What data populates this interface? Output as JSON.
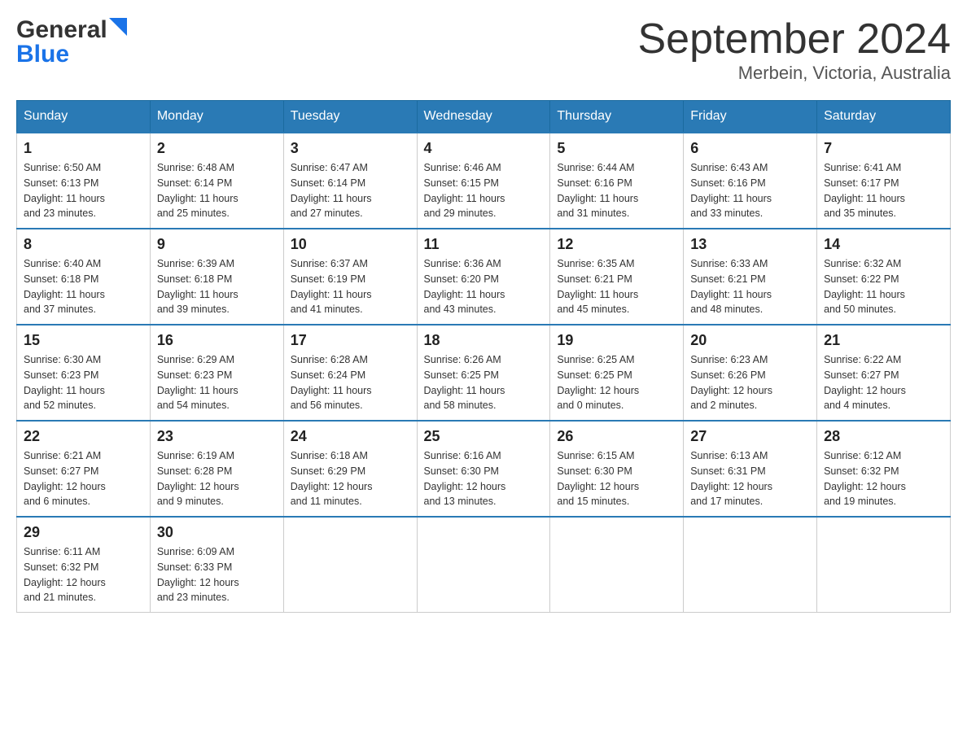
{
  "logo": {
    "general": "General",
    "blue": "Blue"
  },
  "title": "September 2024",
  "subtitle": "Merbein, Victoria, Australia",
  "days": [
    "Sunday",
    "Monday",
    "Tuesday",
    "Wednesday",
    "Thursday",
    "Friday",
    "Saturday"
  ],
  "weeks": [
    [
      {
        "day": "1",
        "sunrise": "6:50 AM",
        "sunset": "6:13 PM",
        "daylight": "11 hours and 23 minutes."
      },
      {
        "day": "2",
        "sunrise": "6:48 AM",
        "sunset": "6:14 PM",
        "daylight": "11 hours and 25 minutes."
      },
      {
        "day": "3",
        "sunrise": "6:47 AM",
        "sunset": "6:14 PM",
        "daylight": "11 hours and 27 minutes."
      },
      {
        "day": "4",
        "sunrise": "6:46 AM",
        "sunset": "6:15 PM",
        "daylight": "11 hours and 29 minutes."
      },
      {
        "day": "5",
        "sunrise": "6:44 AM",
        "sunset": "6:16 PM",
        "daylight": "11 hours and 31 minutes."
      },
      {
        "day": "6",
        "sunrise": "6:43 AM",
        "sunset": "6:16 PM",
        "daylight": "11 hours and 33 minutes."
      },
      {
        "day": "7",
        "sunrise": "6:41 AM",
        "sunset": "6:17 PM",
        "daylight": "11 hours and 35 minutes."
      }
    ],
    [
      {
        "day": "8",
        "sunrise": "6:40 AM",
        "sunset": "6:18 PM",
        "daylight": "11 hours and 37 minutes."
      },
      {
        "day": "9",
        "sunrise": "6:39 AM",
        "sunset": "6:18 PM",
        "daylight": "11 hours and 39 minutes."
      },
      {
        "day": "10",
        "sunrise": "6:37 AM",
        "sunset": "6:19 PM",
        "daylight": "11 hours and 41 minutes."
      },
      {
        "day": "11",
        "sunrise": "6:36 AM",
        "sunset": "6:20 PM",
        "daylight": "11 hours and 43 minutes."
      },
      {
        "day": "12",
        "sunrise": "6:35 AM",
        "sunset": "6:21 PM",
        "daylight": "11 hours and 45 minutes."
      },
      {
        "day": "13",
        "sunrise": "6:33 AM",
        "sunset": "6:21 PM",
        "daylight": "11 hours and 48 minutes."
      },
      {
        "day": "14",
        "sunrise": "6:32 AM",
        "sunset": "6:22 PM",
        "daylight": "11 hours and 50 minutes."
      }
    ],
    [
      {
        "day": "15",
        "sunrise": "6:30 AM",
        "sunset": "6:23 PM",
        "daylight": "11 hours and 52 minutes."
      },
      {
        "day": "16",
        "sunrise": "6:29 AM",
        "sunset": "6:23 PM",
        "daylight": "11 hours and 54 minutes."
      },
      {
        "day": "17",
        "sunrise": "6:28 AM",
        "sunset": "6:24 PM",
        "daylight": "11 hours and 56 minutes."
      },
      {
        "day": "18",
        "sunrise": "6:26 AM",
        "sunset": "6:25 PM",
        "daylight": "11 hours and 58 minutes."
      },
      {
        "day": "19",
        "sunrise": "6:25 AM",
        "sunset": "6:25 PM",
        "daylight": "12 hours and 0 minutes."
      },
      {
        "day": "20",
        "sunrise": "6:23 AM",
        "sunset": "6:26 PM",
        "daylight": "12 hours and 2 minutes."
      },
      {
        "day": "21",
        "sunrise": "6:22 AM",
        "sunset": "6:27 PM",
        "daylight": "12 hours and 4 minutes."
      }
    ],
    [
      {
        "day": "22",
        "sunrise": "6:21 AM",
        "sunset": "6:27 PM",
        "daylight": "12 hours and 6 minutes."
      },
      {
        "day": "23",
        "sunrise": "6:19 AM",
        "sunset": "6:28 PM",
        "daylight": "12 hours and 9 minutes."
      },
      {
        "day": "24",
        "sunrise": "6:18 AM",
        "sunset": "6:29 PM",
        "daylight": "12 hours and 11 minutes."
      },
      {
        "day": "25",
        "sunrise": "6:16 AM",
        "sunset": "6:30 PM",
        "daylight": "12 hours and 13 minutes."
      },
      {
        "day": "26",
        "sunrise": "6:15 AM",
        "sunset": "6:30 PM",
        "daylight": "12 hours and 15 minutes."
      },
      {
        "day": "27",
        "sunrise": "6:13 AM",
        "sunset": "6:31 PM",
        "daylight": "12 hours and 17 minutes."
      },
      {
        "day": "28",
        "sunrise": "6:12 AM",
        "sunset": "6:32 PM",
        "daylight": "12 hours and 19 minutes."
      }
    ],
    [
      {
        "day": "29",
        "sunrise": "6:11 AM",
        "sunset": "6:32 PM",
        "daylight": "12 hours and 21 minutes."
      },
      {
        "day": "30",
        "sunrise": "6:09 AM",
        "sunset": "6:33 PM",
        "daylight": "12 hours and 23 minutes."
      },
      null,
      null,
      null,
      null,
      null
    ]
  ],
  "labels": {
    "sunrise": "Sunrise:",
    "sunset": "Sunset:",
    "daylight": "Daylight:"
  }
}
